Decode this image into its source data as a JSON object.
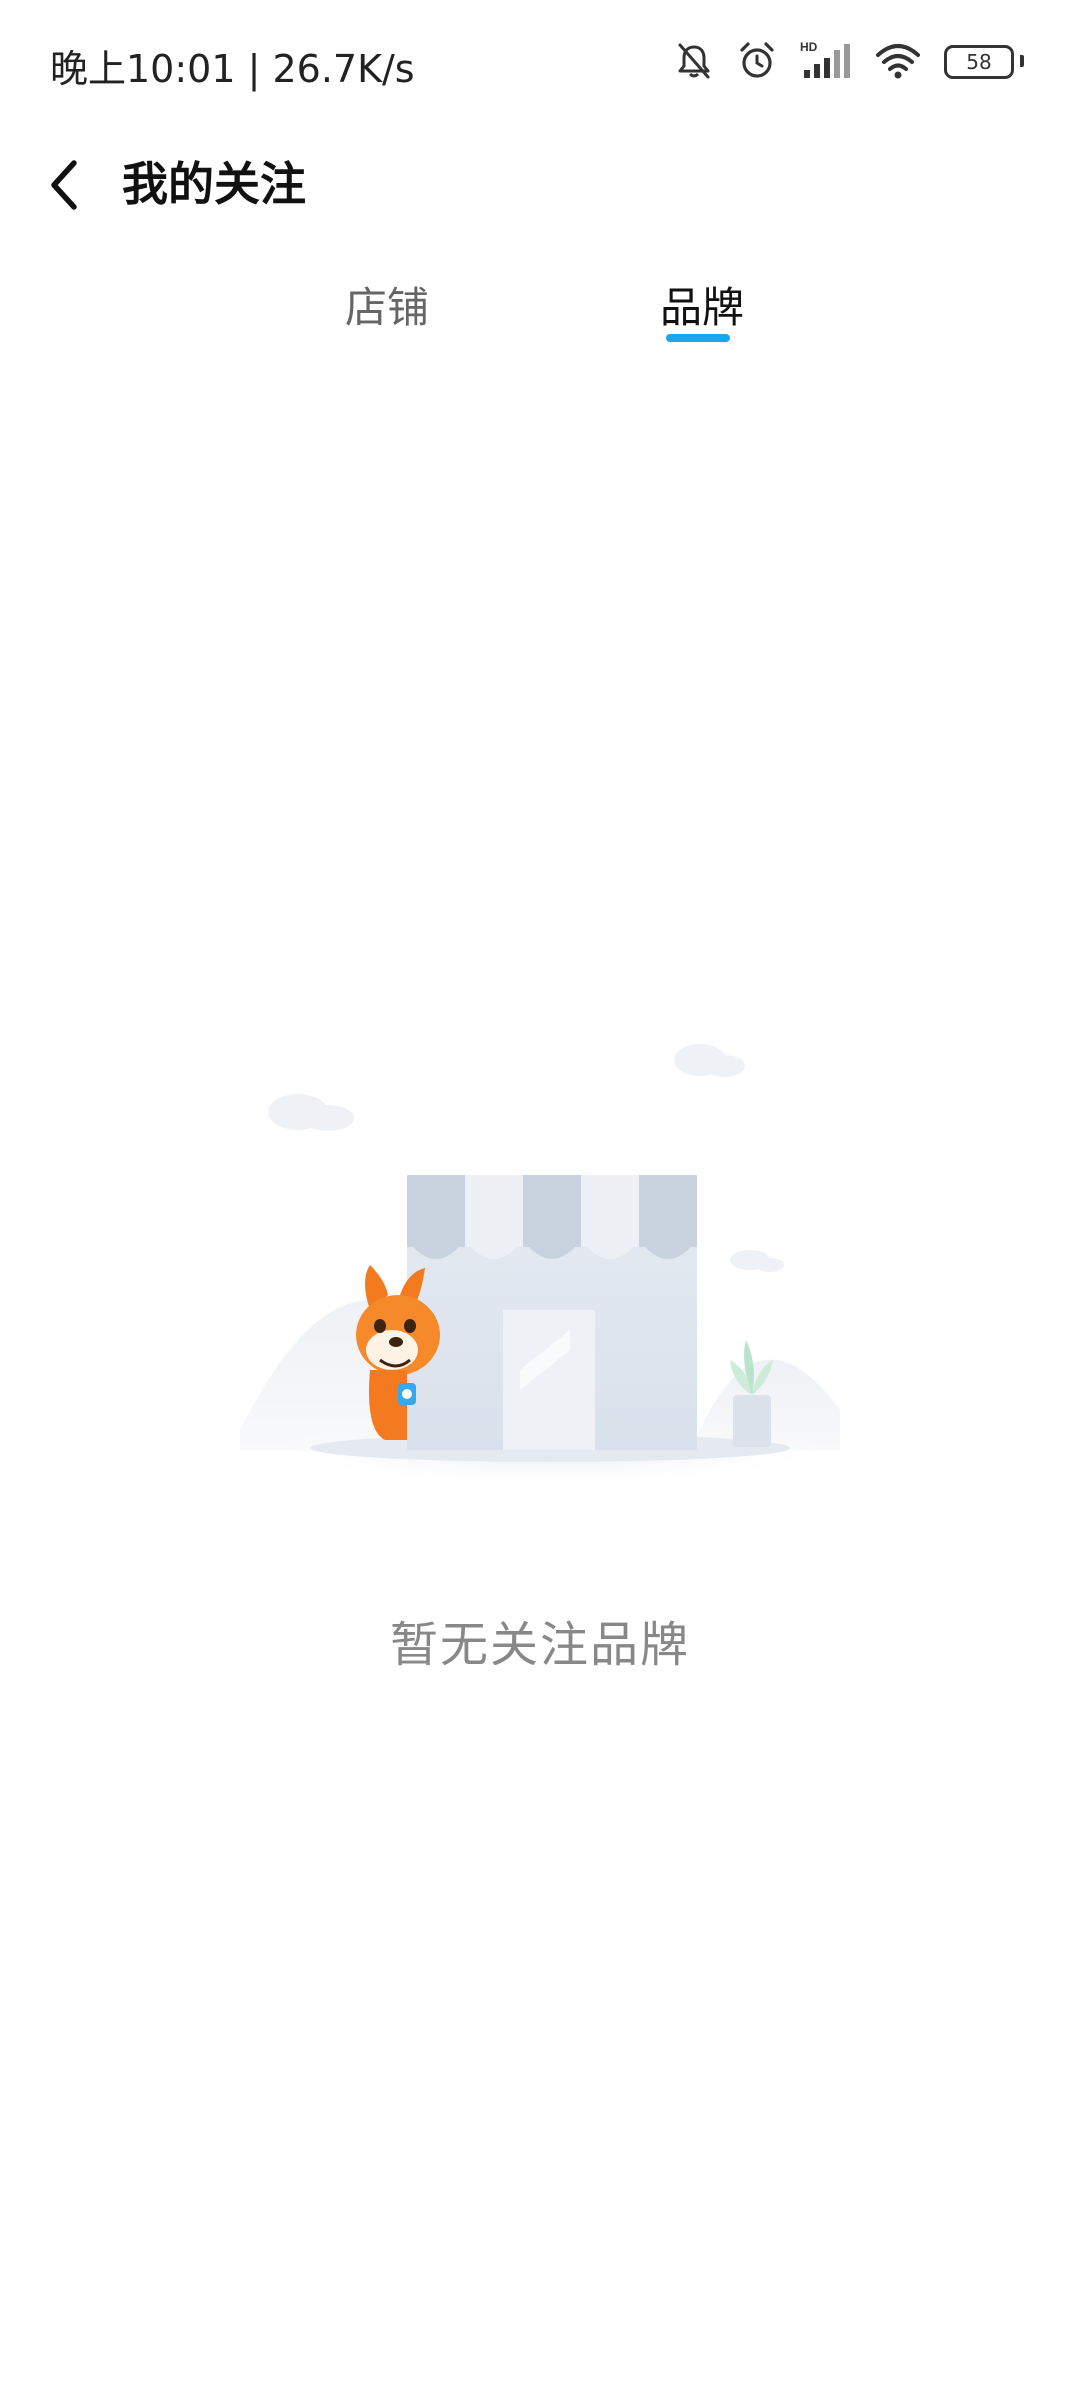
{
  "status_bar": {
    "time_speed": "晚上10:01 | 26.7K/s",
    "battery_level": "58",
    "icons": [
      "bell-off-icon",
      "alarm-icon",
      "hd-signal-icon",
      "wifi-icon",
      "battery-icon"
    ]
  },
  "header": {
    "title": "我的关注",
    "back_icon": "chevron-left-icon"
  },
  "tabs": {
    "items": [
      {
        "label": "店铺",
        "selected": false
      },
      {
        "label": "品牌",
        "selected": true
      }
    ],
    "indicator_color": "#1aa7ee"
  },
  "empty_state": {
    "message": "暂无关注品牌",
    "illustration": "store-with-shiba-dog"
  }
}
